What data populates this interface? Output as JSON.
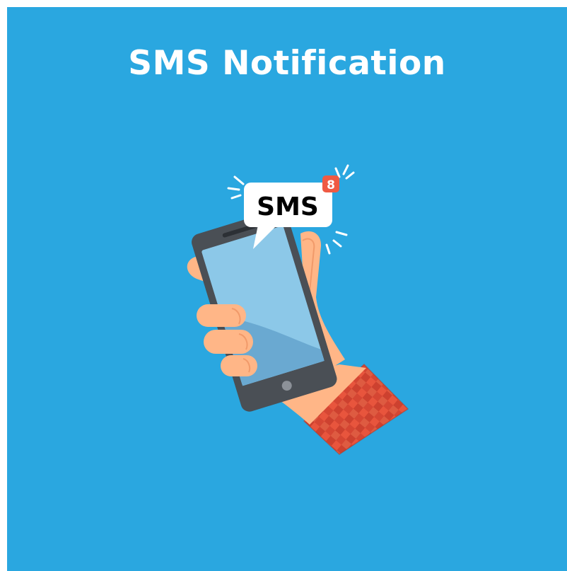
{
  "title": "SMS Notification",
  "bubble": {
    "label": "SMS",
    "badge_count": "8"
  },
  "colors": {
    "background": "#2aa7e0",
    "title": "#ffffff",
    "badge": "#ef5a43",
    "skin": "#ffb687",
    "sleeve": "#e8553d",
    "phone_body": "#4a4f55",
    "screen": "#8cc8e8"
  }
}
